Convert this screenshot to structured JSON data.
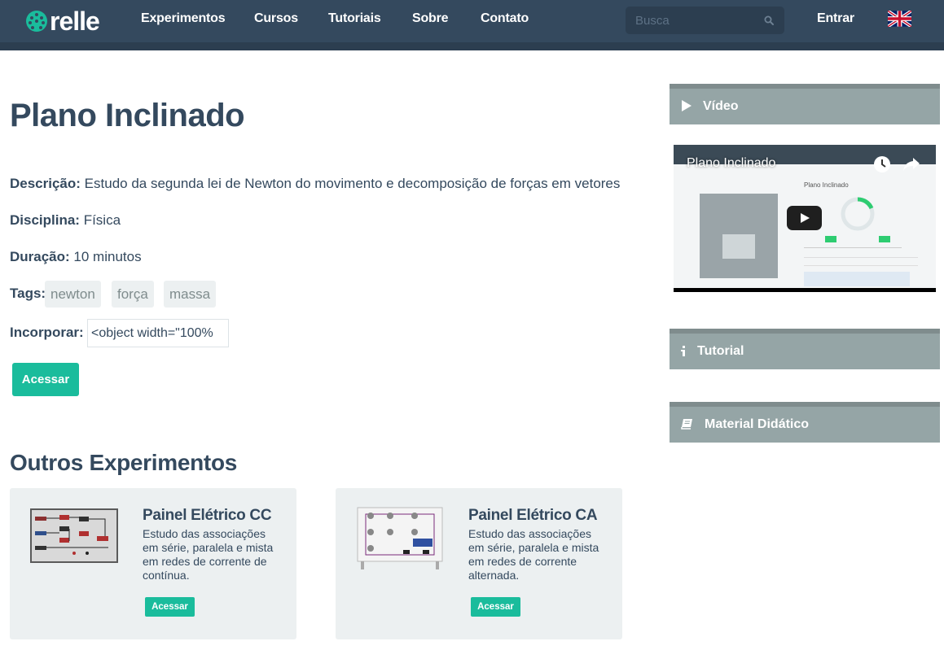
{
  "brand": {
    "name": "relle"
  },
  "nav": {
    "items": [
      "Experimentos",
      "Cursos",
      "Tutoriais",
      "Sobre",
      "Contato"
    ],
    "search_placeholder": "Busca",
    "login": "Entrar"
  },
  "experiment": {
    "title": "Plano Inclinado",
    "description_label": "Descrição:",
    "description": "Estudo da segunda lei de Newton do movimento e decomposição de forças em vetores",
    "discipline_label": "Disciplina:",
    "discipline": "Física",
    "duration_label": "Duração:",
    "duration": "10 minutos",
    "tags_label": "Tags:",
    "tags": [
      "newton",
      "força",
      "massa"
    ],
    "embed_label": "Incorporar:",
    "embed_code": "<object width=\"100%",
    "access_button": "Acessar"
  },
  "others": {
    "title": "Outros Experimentos",
    "cards": [
      {
        "title": "Painel Elétrico CC",
        "description": "Estudo das associações em série, paralela e mista em redes de corrente de contínua.",
        "button": "Acessar"
      },
      {
        "title": "Painel Elétrico CA",
        "description": "Estudo das associações em série, paralela e mista em redes de corrente alternada.",
        "button": "Acessar"
      }
    ]
  },
  "sidebar": {
    "video_label": "Vídeo",
    "video_title": "Plano Inclinado",
    "video_inner_title": "Plano Inclinado",
    "tutorial_label": "Tutorial",
    "material_label": "Material Didático"
  },
  "colors": {
    "navbar": "#34495e",
    "accent": "#1abc9c",
    "panel": "#95a5a6",
    "card_bg": "#ecf0f1"
  }
}
